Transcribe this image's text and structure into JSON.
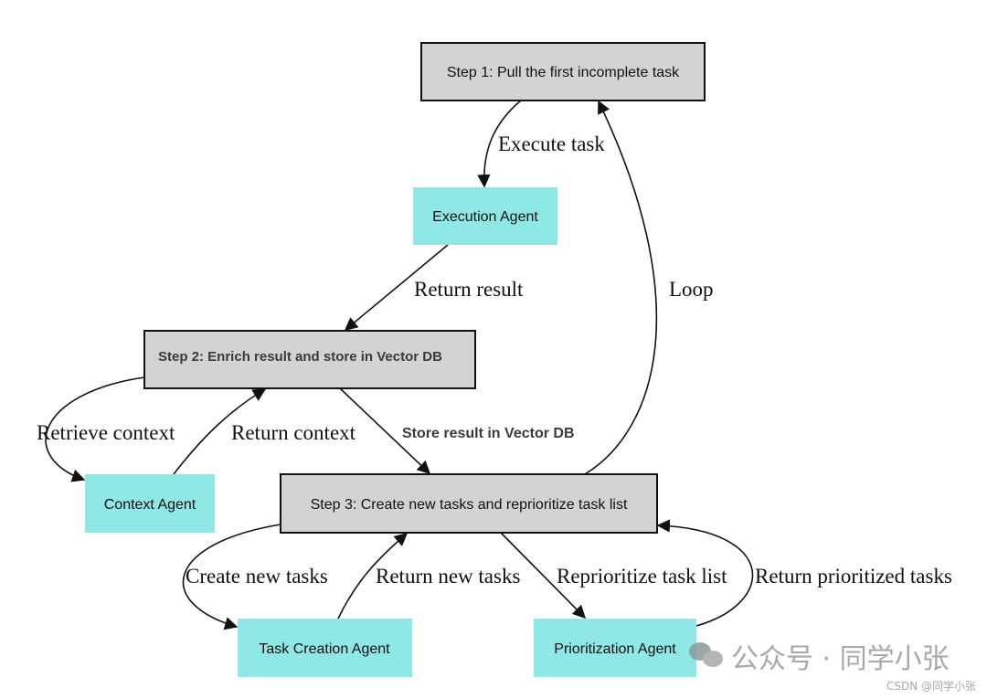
{
  "nodes": {
    "step1": "Step 1: Pull the first incomplete task",
    "execution_agent": "Execution Agent",
    "step2": "Step 2: Enrich result and store in Vector DB",
    "context_agent": "Context Agent",
    "step3": "Step 3: Create new tasks and reprioritize task list",
    "task_creation_agent": "Task Creation Agent",
    "prioritization_agent": "Prioritization Agent"
  },
  "edges": {
    "execute_task": "Execute task",
    "return_result": "Return result",
    "loop": "Loop",
    "retrieve_context": "Retrieve context",
    "return_context": "Return context",
    "store_result": "Store result in Vector DB",
    "create_new_tasks": "Create new tasks",
    "return_new_tasks": "Return new tasks",
    "reprioritize": "Reprioritize task list",
    "return_prioritized": "Return prioritized tasks"
  },
  "colors": {
    "step_fill": "#d3d3d3",
    "agent_fill": "#8fe8e6"
  },
  "watermark": {
    "main": "公众号 · 同学小张",
    "sub": "CSDN @同学小张",
    "icon": "wechat-icon"
  }
}
